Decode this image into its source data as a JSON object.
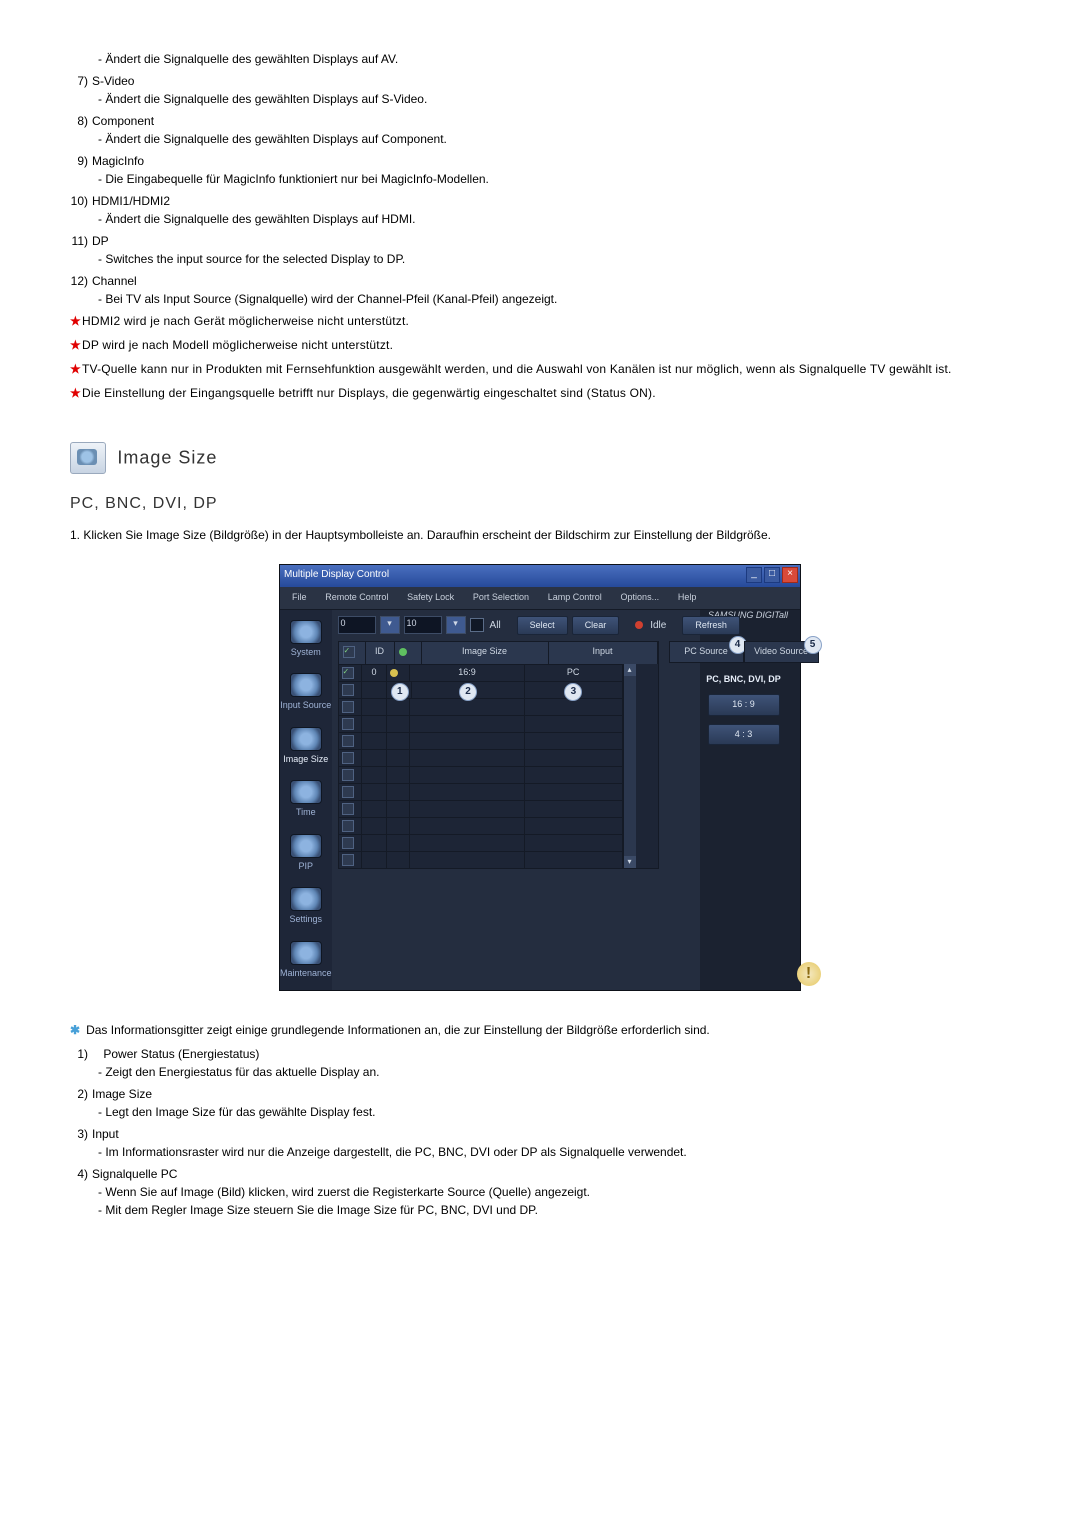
{
  "top_list": [
    {
      "n": "",
      "label": "",
      "desc": "- Ändert die Signalquelle des gewählten Displays auf AV."
    },
    {
      "n": "7)",
      "label": "S-Video",
      "desc": "- Ändert die Signalquelle des gewählten Displays auf S-Video."
    },
    {
      "n": "8)",
      "label": "Component",
      "desc": "- Ändert die Signalquelle des gewählten Displays auf Component."
    },
    {
      "n": "9)",
      "label": "MagicInfo",
      "desc": "- Die Eingabequelle für MagicInfo funktioniert nur bei MagicInfo-Modellen."
    },
    {
      "n": "10)",
      "label": "HDMI1/HDMI2",
      "desc": "- Ändert die Signalquelle des gewählten Displays auf HDMI."
    },
    {
      "n": "11)",
      "label": "DP",
      "desc": "- Switches the input source for the selected Display to DP."
    },
    {
      "n": "12)",
      "label": "Channel",
      "desc": "- Bei TV als Input Source (Signalquelle) wird der Channel-Pfeil (Kanal-Pfeil) angezeigt."
    }
  ],
  "star_notes": [
    "HDMI2 wird je nach Gerät möglicherweise nicht unterstützt.",
    "DP wird je nach Modell möglicherweise nicht unterstützt.",
    "TV-Quelle kann nur in Produkten mit Fernsehfunktion ausgewählt werden, und die Auswahl von Kanälen ist nur möglich, wenn als Signalquelle TV gewählt ist.",
    "Die Einstellung der Eingangsquelle betrifft nur Displays, die gegenwärtig eingeschaltet sind (Status ON)."
  ],
  "section_title": "Image Size",
  "sub_title": "PC, BNC, DVI, DP",
  "step1_n": "1.",
  "step1": "Klicken Sie Image Size (Bildgröße) in der Hauptsymbolleiste an. Daraufhin erscheint der Bildschirm zur Einstellung der Bildgröße.",
  "app": {
    "title": "Multiple Display Control",
    "menus": [
      "File",
      "Remote Control",
      "Safety Lock",
      "Port Selection",
      "Lamp Control",
      "Options...",
      "Help"
    ],
    "brand": "SAMSUNG DIGITall",
    "range_from": "0",
    "range_to": "10",
    "all": "All",
    "btn_select": "Select",
    "btn_clear": "Clear",
    "idle": "Idle",
    "btn_refresh": "Refresh",
    "side": [
      "System",
      "Input Source",
      "Image Size",
      "Time",
      "PIP",
      "Settings",
      "Maintenance"
    ],
    "th_id": "ID",
    "th_imgsize": "Image Size",
    "th_input": "Input",
    "row1_id": "0",
    "row1_size": "16:9",
    "row1_input": "PC",
    "tab_pc": "PC Source",
    "tab_vid": "Video Source",
    "rp_title": "PC, BNC, DVI, DP",
    "rp_btn1": "16 : 9",
    "rp_btn2": "4 : 3",
    "b1": "1",
    "b2": "2",
    "b3": "3",
    "b4": "4",
    "b5": "5",
    "warn": "!"
  },
  "info_note": "Das Informationsgitter zeigt einige grundlegende Informationen an, die zur Einstellung der Bildgröße erforderlich sind.",
  "bottom_list": [
    {
      "n": "1)",
      "label": "Power Status (Energiestatus)",
      "desc": "- Zeigt den Energiestatus für das aktuelle Display an.",
      "indent": true
    },
    {
      "n": "2)",
      "label": "Image Size",
      "desc": "- Legt den Image Size für das gewählte Display fest."
    },
    {
      "n": "3)",
      "label": "Input",
      "desc": "- Im Informationsraster wird nur die Anzeige dargestellt, die PC, BNC, DVI oder DP als Signalquelle verwendet."
    },
    {
      "n": "4)",
      "label": "Signalquelle PC",
      "desc": "- Wenn Sie auf Image (Bild) klicken, wird zuerst die Registerkarte Source (Quelle) angezeigt.",
      "desc2": "- Mit dem Regler Image Size steuern Sie die Image Size für PC, BNC, DVI und DP."
    }
  ]
}
